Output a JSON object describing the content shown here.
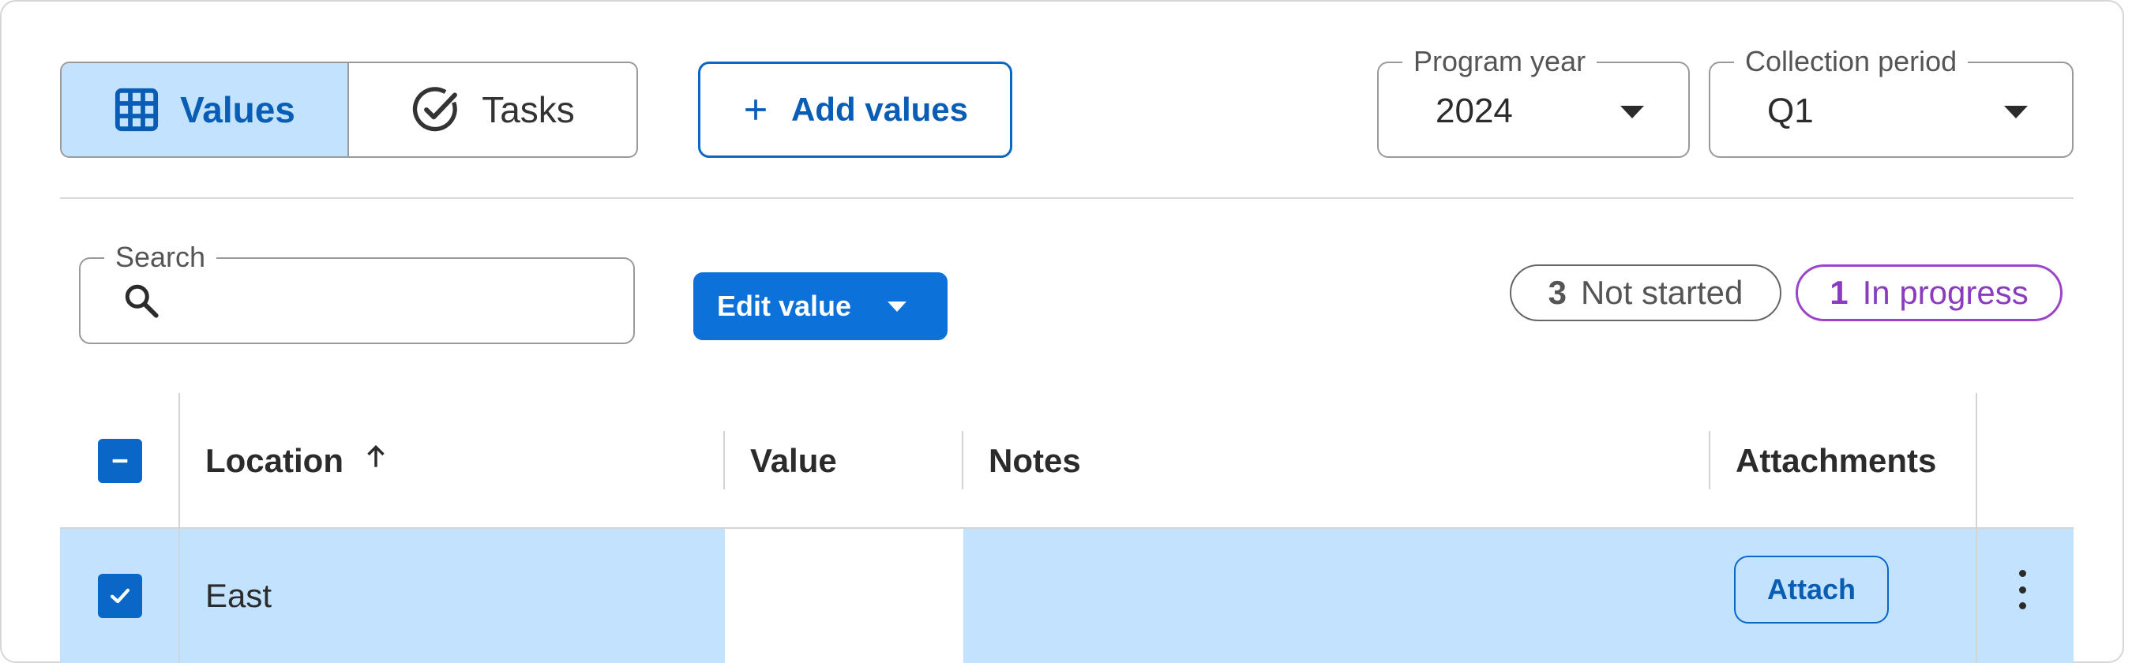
{
  "view_toggle": {
    "values_label": "Values",
    "tasks_label": "Tasks",
    "values_icon": "grid-icon",
    "tasks_icon": "check-circle-icon"
  },
  "add_values": {
    "label": "Add values",
    "icon": "plus-icon"
  },
  "program_year": {
    "label": "Program year",
    "value": "2024"
  },
  "collection_period": {
    "label": "Collection period",
    "value": "Q1"
  },
  "search": {
    "label": "Search",
    "value": "",
    "placeholder": ""
  },
  "edit_value": {
    "label": "Edit value"
  },
  "status_pills": [
    {
      "count": "3",
      "label": "Not started",
      "color": "#666666"
    },
    {
      "count": "1",
      "label": "In progress",
      "color": "#9b43c9"
    }
  ],
  "table": {
    "columns": [
      "Location",
      "Value",
      "Notes",
      "Attachments"
    ],
    "sort": {
      "column": "Location",
      "direction": "ascending"
    },
    "header_checkbox": "indeterminate",
    "rows": [
      {
        "selected": true,
        "location": "East",
        "value": "",
        "notes": "",
        "attach_label": "Attach"
      }
    ]
  },
  "colors": {
    "accent": "#0c72d9",
    "selected_bg": "#c2e2fd",
    "in_progress": "#9b43c9"
  }
}
